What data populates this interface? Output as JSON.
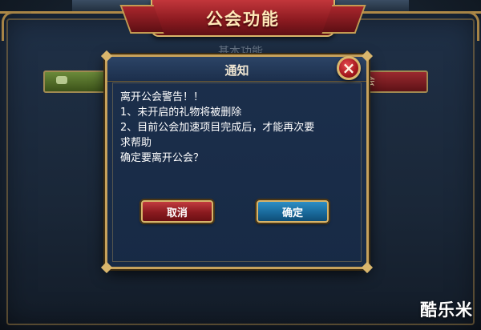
{
  "header": {
    "title": "公会功能",
    "section_label": "基本功能"
  },
  "side_buttons": {
    "right_label": "会"
  },
  "dialog": {
    "title": "通知",
    "close_symbol": "×",
    "message_lines": [
      "离开公会警告！！",
      "1、未开启的礼物将被删除",
      "2、目前公会加速项目完成后，才能再次要",
      "求帮助",
      "确定要离开公会？"
    ],
    "cancel_label": "取消",
    "confirm_label": "确定"
  },
  "watermark": "酷乐米",
  "colors": {
    "ribbon_red": "#8e1b21",
    "gold_border": "#c7a25c",
    "dialog_bg": "#1c2f4c",
    "cancel_red": "#c23b3f",
    "confirm_blue": "#2d8ec4"
  }
}
